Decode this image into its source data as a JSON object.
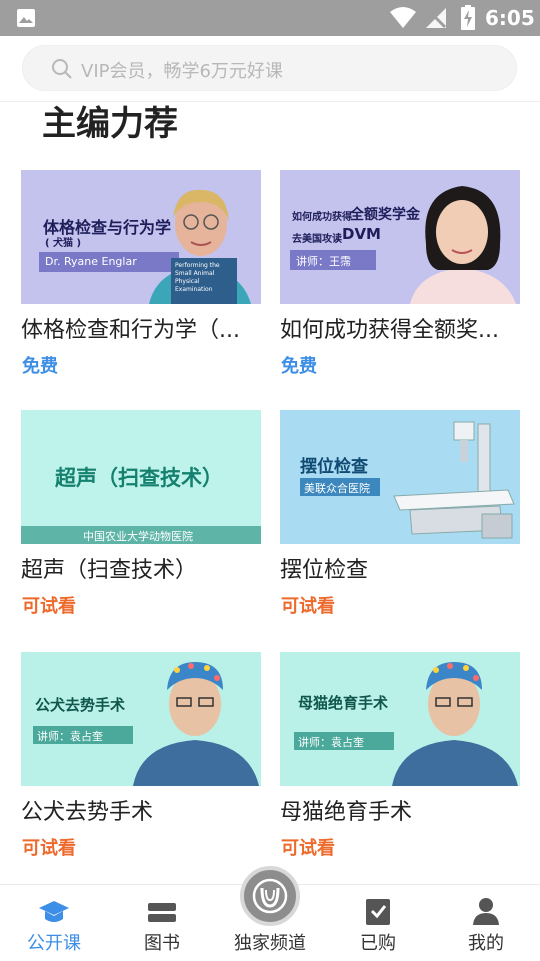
{
  "status_bar": {
    "time": "6:05"
  },
  "search": {
    "placeholder": "VIP会员，畅学6万元好课"
  },
  "section": {
    "title": "主编力荐"
  },
  "courses": [
    {
      "title": "体格检查和行为学（...",
      "badge": "免费",
      "thumb": {
        "headline": "体格检查与行为学",
        "sub": "( 犬猫 )",
        "lecturer": "Dr. Ryane Englar",
        "book": "Performing the Small Animal Physical Examination"
      }
    },
    {
      "title": "如何成功获得全额奖...",
      "badge": "免费",
      "thumb": {
        "line1a": "如何成功获得",
        "line1b": "全额奖学金",
        "line2a": "去美国攻读",
        "line2b": "DVM",
        "lecturer": "讲师：王霈"
      }
    },
    {
      "title": "超声（扫查技术）",
      "badge": "可试看",
      "thumb": {
        "headline": "超声（扫查技术）",
        "footer": "中国农业大学动物医院"
      }
    },
    {
      "title": "摆位检查",
      "badge": "可试看",
      "thumb": {
        "headline": "摆位检查",
        "sub": "美联众合医院"
      }
    },
    {
      "title": "公犬去势手术",
      "badge": "可试看",
      "thumb": {
        "headline": "公犬去势手术",
        "lecturer": "讲师：袁占奎"
      }
    },
    {
      "title": "母猫绝育手术",
      "badge": "可试看",
      "thumb": {
        "headline": "母猫绝育手术",
        "lecturer": "讲师：袁占奎"
      }
    }
  ],
  "nav": {
    "items": [
      {
        "label": "公开课",
        "icon": "graduation-cap-icon",
        "active": true
      },
      {
        "label": "图书",
        "icon": "books-icon",
        "active": false
      },
      {
        "label": "独家频道",
        "icon": "channel-logo-icon",
        "active": false
      },
      {
        "label": "已购",
        "icon": "check-clipboard-icon",
        "active": false
      },
      {
        "label": "我的",
        "icon": "person-icon",
        "active": false
      }
    ]
  },
  "colors": {
    "accent": "#3d8ee6",
    "trial": "#ee6a2c",
    "thumb_purple": "#c3c2ee",
    "thumb_mint": "#b8f2ea",
    "thumb_blue": "#a8dcf2"
  }
}
